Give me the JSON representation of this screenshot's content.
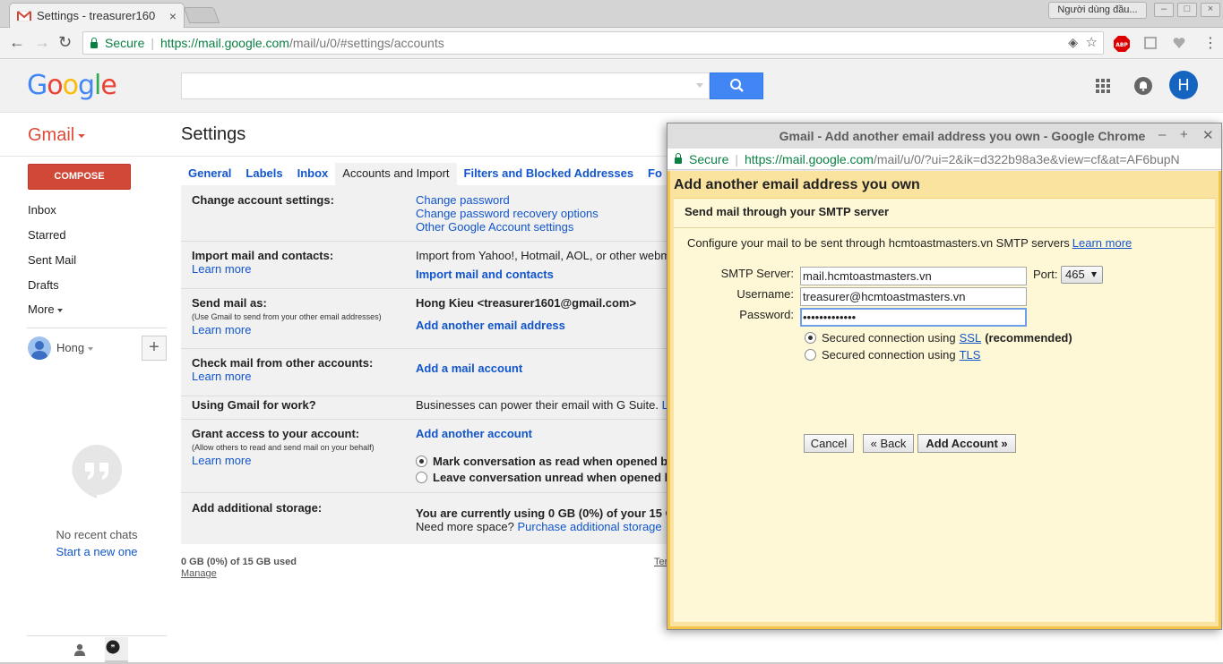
{
  "browser": {
    "tab_title": "Settings - treasurer160",
    "tab_close": "×",
    "profile_label": "Người dùng đầu...",
    "secure_label": "Secure",
    "url_scheme_host": "https://mail.google.com",
    "url_path": "/mail/u/0/#settings/accounts"
  },
  "gmail": {
    "label": "Gmail",
    "settings_title": "Settings",
    "compose_label": "COMPOSE",
    "nav": [
      "Inbox",
      "Starred",
      "Sent Mail",
      "Drafts"
    ],
    "more_label": "More",
    "user_name": "Hong",
    "avatar_letter": "H",
    "no_chats": "No recent chats",
    "start_new": "Start a new one",
    "tabs": [
      "General",
      "Labels",
      "Inbox",
      "Accounts and Import",
      "Filters and Blocked Addresses",
      "Fo"
    ],
    "active_tab": "Accounts and Import",
    "sections": {
      "change_account": {
        "label": "Change account settings:",
        "links": [
          "Change password",
          "Change password recovery options",
          "Other Google Account settings"
        ]
      },
      "import": {
        "label": "Import mail and contacts:",
        "learn": "Learn more",
        "text": "Import from Yahoo!, Hotmail, AOL, or other webm",
        "action": "Import mail and contacts"
      },
      "send_as": {
        "label": "Send mail as:",
        "note": "(Use Gmail to send from your other email addresses)",
        "learn": "Learn more",
        "account": "Hong Kieu <treasurer1601@gmail.com>",
        "action": "Add another email address"
      },
      "check_mail": {
        "label": "Check mail from other accounts:",
        "learn": "Learn more",
        "action": "Add a mail account"
      },
      "work": {
        "label": "Using Gmail for work?",
        "text": "Businesses can power their email with G Suite.",
        "link": "Le"
      },
      "grant": {
        "label": "Grant access to your account:",
        "note": "(Allow others to read and send mail on your behalf)",
        "learn": "Learn more",
        "action": "Add another account",
        "radio1": "Mark conversation as read when opened by",
        "radio2": "Leave conversation unread when opened b"
      },
      "storage": {
        "label": "Add additional storage:",
        "text": "You are currently using 0 GB (0%) of your 15 G",
        "need": "Need more space?",
        "link": "Purchase additional storage"
      }
    },
    "storage_used": "0 GB (0%) of 15 GB used",
    "manage": "Manage",
    "terms": "Ter"
  },
  "popup": {
    "window_title": "Gmail - Add another email address you own - Google Chrome",
    "secure_label": "Secure",
    "url_scheme_host": "https://mail.google.com",
    "url_path": "/mail/u/0/?ui=2&ik=d322b98a3e&view=cf&at=AF6bupN",
    "heading": "Add another email address you own",
    "subheading": "Send mail through your SMTP server",
    "description": "Configure your mail to be sent through hcmtoastmasters.vn SMTP servers",
    "learn_more": "Learn more",
    "smtp_label": "SMTP Server:",
    "smtp_value": "mail.hcmtoastmasters.vn",
    "port_label": "Port:",
    "port_value": "465",
    "username_label": "Username:",
    "username_value": "treasurer@hcmtoastmasters.vn",
    "password_label": "Password:",
    "password_value": "•••••••••••••",
    "ssl_prefix": "Secured connection using",
    "ssl_link": "SSL",
    "ssl_suffix": "(recommended)",
    "tls_prefix": "Secured connection using",
    "tls_link": "TLS",
    "cancel": "Cancel",
    "back": "« Back",
    "add": "Add Account »"
  }
}
